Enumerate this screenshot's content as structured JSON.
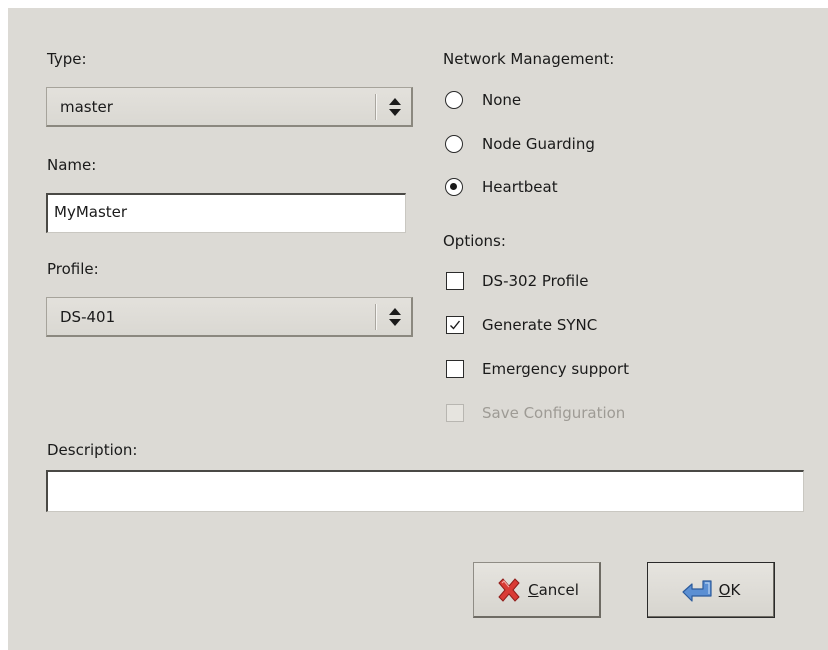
{
  "left": {
    "type_label": "Type:",
    "type_value": "master",
    "name_label": "Name:",
    "name_value": "MyMaster",
    "profile_label": "Profile:",
    "profile_value": "DS-401"
  },
  "network": {
    "label": "Network Management:",
    "options": [
      {
        "label": "None",
        "selected": false
      },
      {
        "label": "Node Guarding",
        "selected": false
      },
      {
        "label": "Heartbeat",
        "selected": true
      }
    ]
  },
  "options": {
    "label": "Options:",
    "items": [
      {
        "label": "DS-302 Profile",
        "checked": false,
        "enabled": true
      },
      {
        "label": "Generate SYNC",
        "checked": true,
        "enabled": true
      },
      {
        "label": "Emergency support",
        "checked": false,
        "enabled": true
      },
      {
        "label": "Save Configuration",
        "checked": false,
        "enabled": false
      }
    ]
  },
  "description": {
    "label": "Description:",
    "value": ""
  },
  "buttons": {
    "cancel_mnemonic": "C",
    "cancel_rest": "ancel",
    "ok_mnemonic": "O",
    "ok_rest": "K"
  },
  "icons": {
    "cancel": "red-x-icon",
    "ok": "blue-return-arrow-icon",
    "combo": "up-down-arrows-icon"
  },
  "colors": {
    "dialog_bg": "#dcdad5",
    "cancel_icon": "#d93b35",
    "ok_icon": "#5b8fd3"
  }
}
